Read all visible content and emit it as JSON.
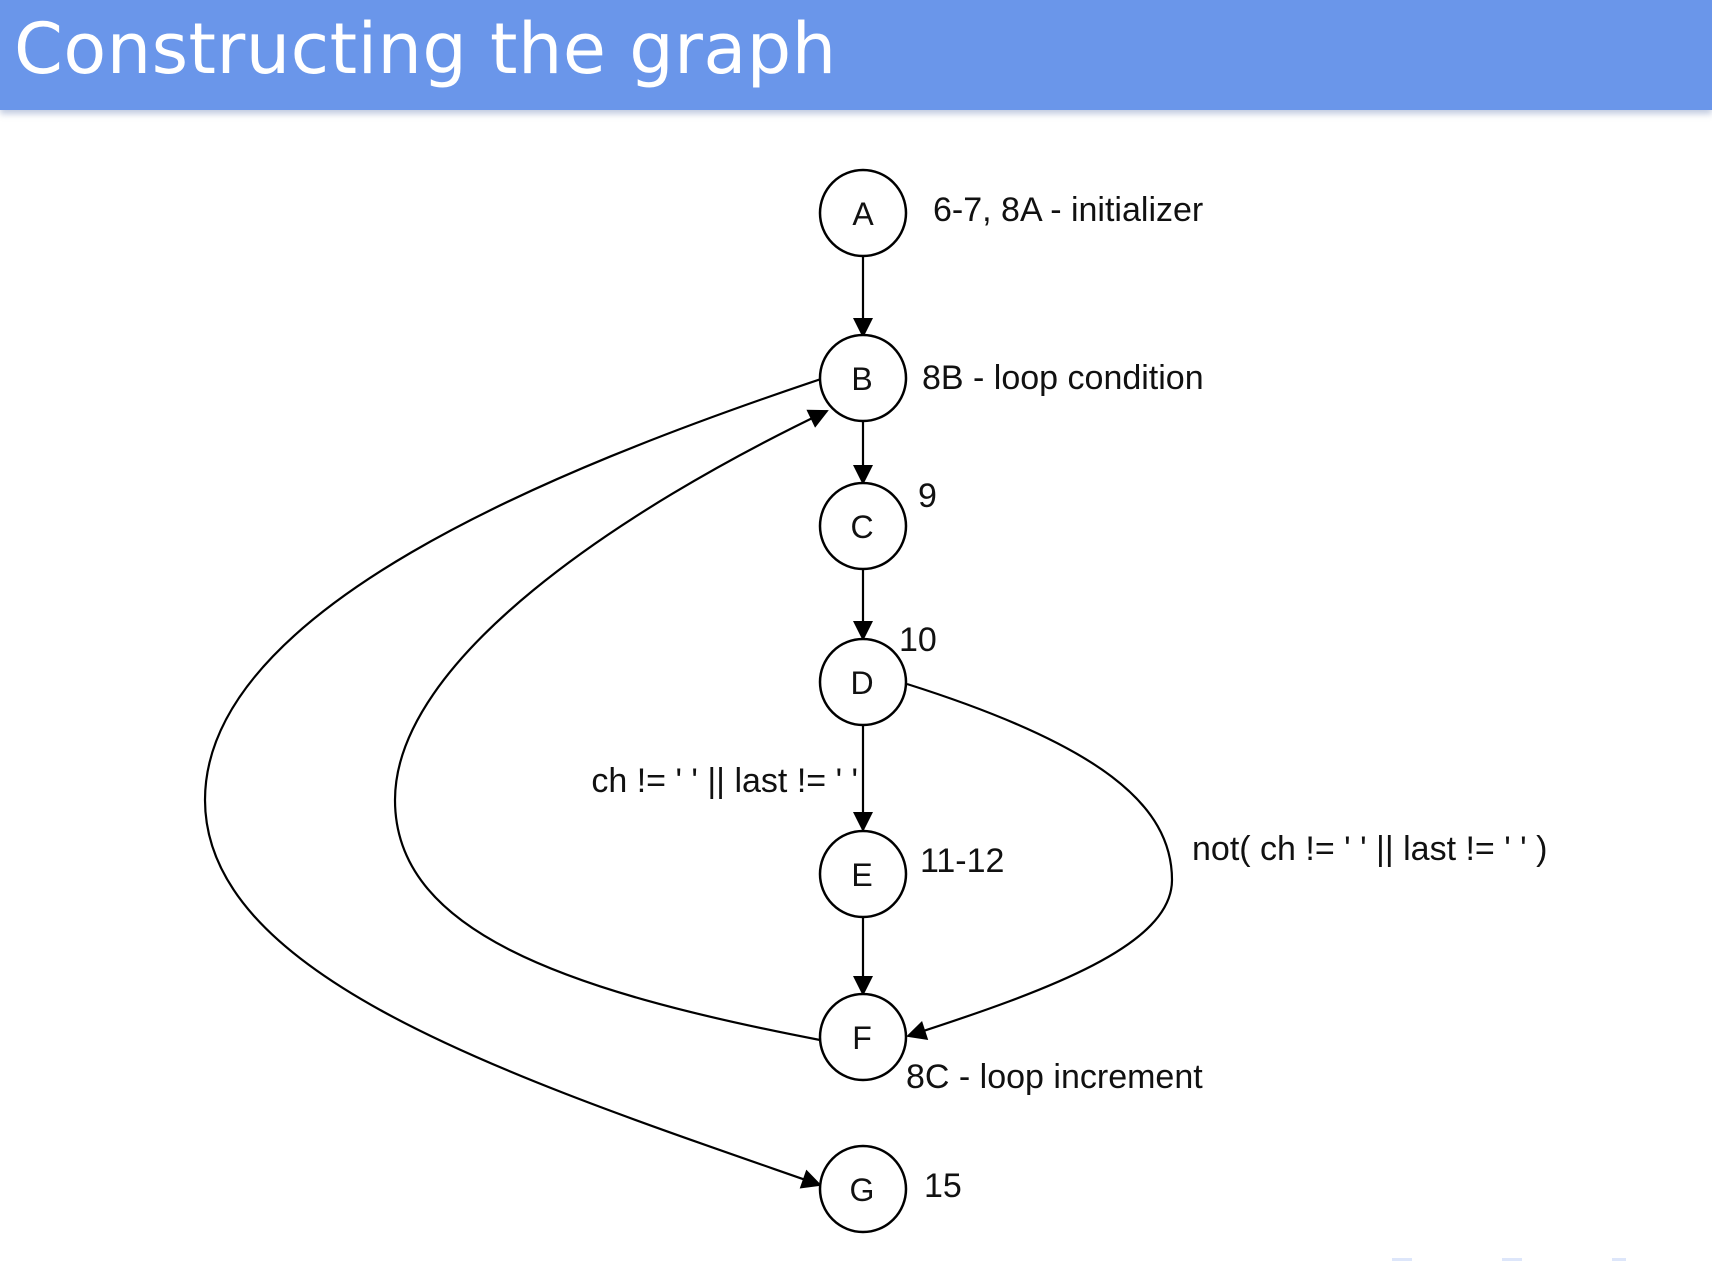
{
  "slide": {
    "title": "Constructing the graph",
    "accent_color": "#6a96ea"
  },
  "diagram": {
    "nodes": [
      {
        "id": "A",
        "note": "6-7, 8A - initializer"
      },
      {
        "id": "B",
        "note": "8B - loop condition"
      },
      {
        "id": "C",
        "note": "9"
      },
      {
        "id": "D",
        "note": "10"
      },
      {
        "id": "E",
        "note": "11-12"
      },
      {
        "id": "F",
        "note": "8C - loop increment"
      },
      {
        "id": "G",
        "note": "15"
      }
    ],
    "edges": [
      {
        "from": "A",
        "to": "B",
        "label": ""
      },
      {
        "from": "B",
        "to": "C",
        "label": ""
      },
      {
        "from": "C",
        "to": "D",
        "label": ""
      },
      {
        "from": "D",
        "to": "E",
        "label": "ch != ' ' || last != ' '"
      },
      {
        "from": "E",
        "to": "F",
        "label": ""
      },
      {
        "from": "D",
        "to": "F",
        "label": "not( ch != ' ' || last != ' ' )"
      },
      {
        "from": "F",
        "to": "B",
        "label": ""
      },
      {
        "from": "B",
        "to": "G",
        "label": ""
      }
    ]
  }
}
